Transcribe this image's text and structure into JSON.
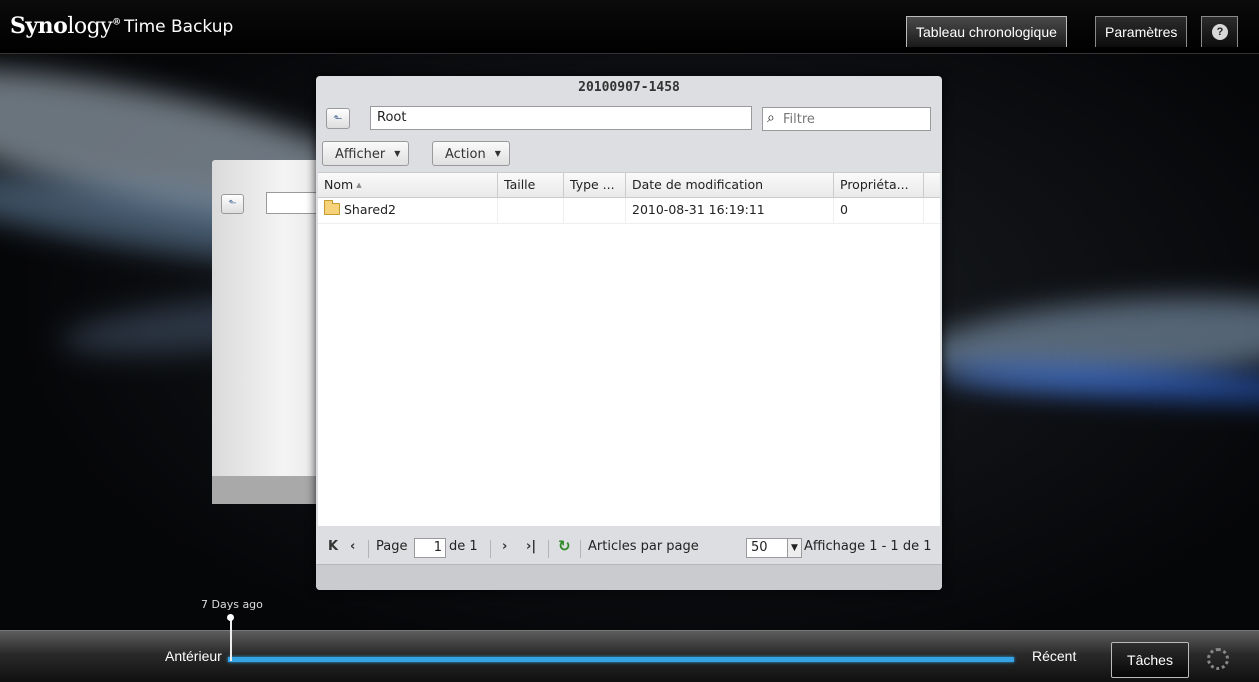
{
  "app": {
    "brand": "Synology",
    "brand_bold": "Syno",
    "brand_light": "logy",
    "trademark": "®",
    "name": "Time Backup"
  },
  "top_tabs": [
    {
      "label": "Tableau chronologique",
      "active": true
    },
    {
      "label": "Paramètres",
      "active": false
    }
  ],
  "help": {
    "label": "?"
  },
  "window": {
    "title": "20100907-1458",
    "path_value": "Root",
    "filter_placeholder": "Filtre",
    "menus": [
      {
        "label": "Afficher"
      },
      {
        "label": "Action"
      }
    ],
    "columns": [
      "Nom",
      "Taille",
      "Type ...",
      "Date de modification",
      "Propriéta..."
    ],
    "rows": [
      {
        "name": "Shared2",
        "size": "",
        "type": "",
        "modified": "2010-08-31 16:19:11",
        "owner": "0"
      }
    ],
    "pager": {
      "page_label": "Page",
      "page_value": "1",
      "of_label": "de 1",
      "per_page_label": "Articles par page",
      "per_page_value": "50",
      "display_label": "Affichage 1 - 1 de 1"
    }
  },
  "timeline": {
    "marker_label": "7 Days ago",
    "older_label": "Antérieur",
    "recent_label": "Récent",
    "tasks_label": "Tâches",
    "accent_color": "#33a3e6"
  },
  "icons": {
    "up": "up-arrow-icon",
    "search": "search-icon",
    "folder": "folder-icon",
    "first": "first-page-icon",
    "prev": "prev-page-icon",
    "next": "next-page-icon",
    "last": "last-page-icon",
    "refresh": "refresh-icon",
    "spinner": "spinner-icon"
  }
}
